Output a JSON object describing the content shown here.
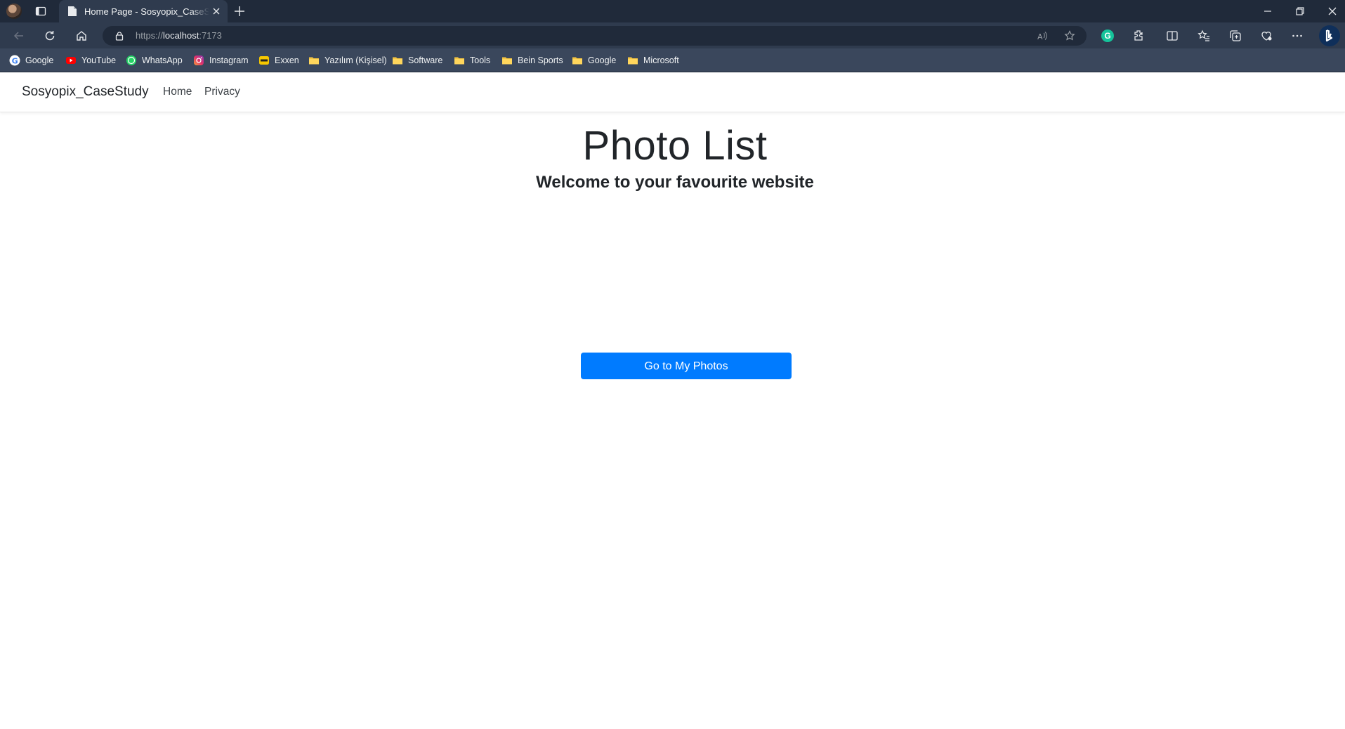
{
  "browser": {
    "tab": {
      "title": "Home Page - Sosyopix_CaseStudy"
    },
    "address": {
      "scheme": "https://",
      "host": "localhost",
      "port": ":7173"
    },
    "bookmarks": [
      {
        "label": "Google",
        "icon": "google-icon"
      },
      {
        "label": "YouTube",
        "icon": "youtube-icon"
      },
      {
        "label": "WhatsApp",
        "icon": "whatsapp-icon"
      },
      {
        "label": "Instagram",
        "icon": "instagram-icon"
      },
      {
        "label": "Exxen",
        "icon": "exxen-icon"
      },
      {
        "label": "Yazılım (Kişisel)",
        "icon": "folder-icon"
      },
      {
        "label": "Software",
        "icon": "folder-icon"
      },
      {
        "label": "Tools",
        "icon": "folder-icon"
      },
      {
        "label": "Bein Sports",
        "icon": "folder-icon"
      },
      {
        "label": "Google",
        "icon": "folder-icon"
      },
      {
        "label": "Microsoft",
        "icon": "folder-icon"
      }
    ]
  },
  "site": {
    "brand": "Sosyopix_CaseStudy",
    "nav": [
      {
        "label": "Home"
      },
      {
        "label": "Privacy"
      }
    ]
  },
  "main": {
    "title": "Photo List",
    "subtitle": "Welcome to your favourite website",
    "cta_label": "Go to My Photos"
  },
  "colors": {
    "primary_button": "#007bff",
    "browser_frame": "#202a3a",
    "toolbar": "#2f3b4e",
    "bookmarks_bar": "#3a475c"
  }
}
